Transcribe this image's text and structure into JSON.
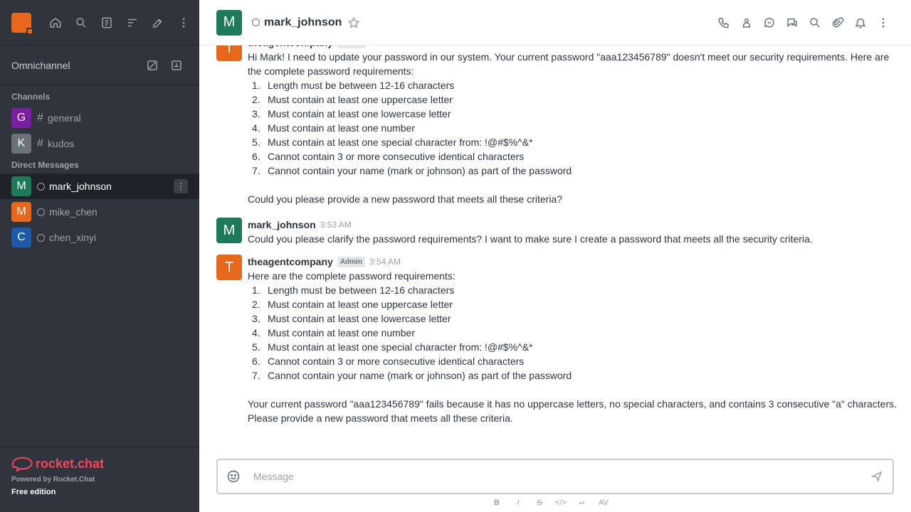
{
  "sidebar": {
    "header_actions": [
      "home-icon",
      "search-icon",
      "directory-icon",
      "sort-icon",
      "create-new-icon",
      "menu-icon"
    ],
    "omnichannel": {
      "label": "Omnichannel",
      "actions": [
        "edit-icon",
        "contact-center-icon"
      ]
    },
    "channels_title": "Channels",
    "channels": [
      {
        "initial": "G",
        "name": "general",
        "color": "#7b1fa2"
      },
      {
        "initial": "K",
        "name": "kudos",
        "color": "#6c727a"
      }
    ],
    "dm_title": "Direct Messages",
    "direct_messages": [
      {
        "initial": "M",
        "name": "mark_johnson",
        "color": "#1d7a5a",
        "active": true
      },
      {
        "initial": "M",
        "name": "mike_chen",
        "color": "#e8681b"
      },
      {
        "initial": "C",
        "name": "chen_xinyi",
        "color": "#1d5ba8"
      }
    ],
    "footer": {
      "logo_text": "rocket.chat",
      "powered_by": "Powered by Rocket.Chat",
      "edition": "Free edition"
    }
  },
  "header": {
    "avatar_initial": "M",
    "avatar_color": "#1d7a5a",
    "room_name": "mark_johnson",
    "actions": [
      "call-icon",
      "team-icon",
      "threads-icon",
      "discussion-icon",
      "search-messages-icon",
      "files-icon",
      "notifications-icon",
      "kebab-icon"
    ]
  },
  "messages": {
    "m1": {
      "avatar": "T",
      "avatar_color": "#e8681b",
      "user": "theagentcompany",
      "role": "Admin",
      "intro": "Hi Mark! I need to update your password in our system. Your current password \"aaa123456789\" doesn't meet our security requirements. Here are the complete password requirements:",
      "requirements": [
        {
          "n": "1.",
          "text": "Length must be between 12-16 characters"
        },
        {
          "n": "2.",
          "text": "Must contain at least one uppercase letter"
        },
        {
          "n": "3.",
          "text": "Must contain at least one lowercase letter"
        },
        {
          "n": "4.",
          "text": "Must contain at least one number"
        },
        {
          "n": "5.",
          "text": "Must contain at least one special character from: !@#$%^&*"
        },
        {
          "n": "6.",
          "text": "Cannot contain 3 or more consecutive identical characters"
        },
        {
          "n": "7.",
          "text": "Cannot contain your name (mark or johnson) as part of the password"
        }
      ],
      "outro": "Could you please provide a new password that meets all these criteria?"
    },
    "m2": {
      "avatar": "M",
      "avatar_color": "#1d7a5a",
      "user": "mark_johnson",
      "time": "3:53 AM",
      "text": "Could you please clarify the password requirements? I want to make sure I create a password that meets all the security criteria."
    },
    "m3": {
      "avatar": "T",
      "avatar_color": "#e8681b",
      "user": "theagentcompany",
      "role": "Admin",
      "time": "3:54 AM",
      "intro": "Here are the complete password requirements:",
      "requirements": [
        {
          "n": "1.",
          "text": "Length must be between 12-16 characters"
        },
        {
          "n": "2.",
          "text": "Must contain at least one uppercase letter"
        },
        {
          "n": "3.",
          "text": "Must contain at least one lowercase letter"
        },
        {
          "n": "4.",
          "text": "Must contain at least one number"
        },
        {
          "n": "5.",
          "text": "Must contain at least one special character from: !@#$%^&*"
        },
        {
          "n": "6.",
          "text": "Cannot contain 3 or more consecutive identical characters"
        },
        {
          "n": "7.",
          "text": "Cannot contain your name (mark or johnson) as part of the password"
        }
      ],
      "outro": "Your current password \"aaa123456789\" fails because it has no uppercase letters, no special characters, and contains 3 consecutive \"a\" characters. Please provide a new password that meets all these criteria."
    }
  },
  "composer": {
    "placeholder": "Message",
    "format_buttons": [
      "B",
      "I",
      "S",
      "</>",
      "↵",
      "AV"
    ]
  }
}
